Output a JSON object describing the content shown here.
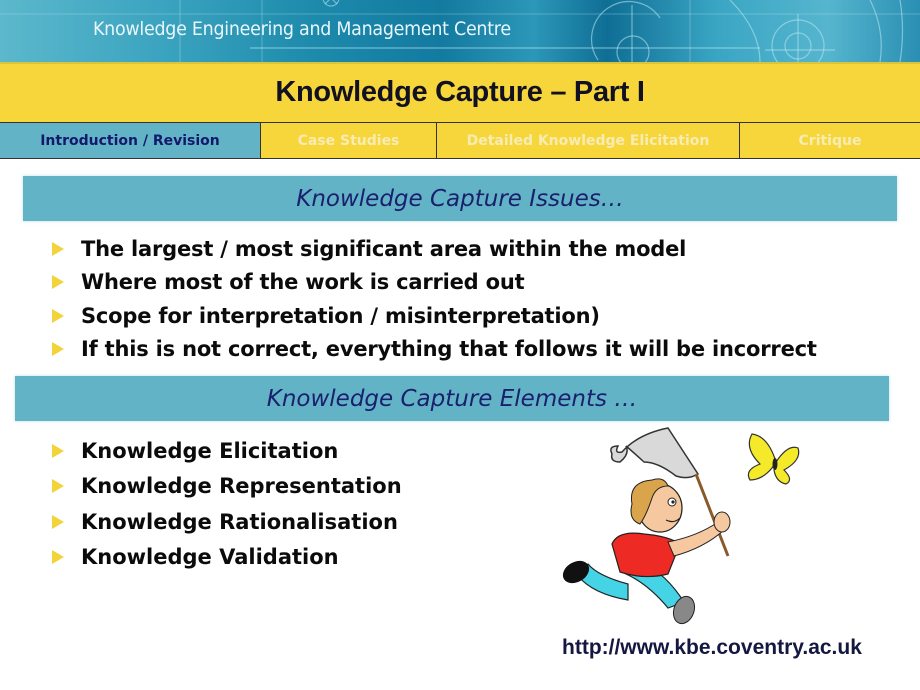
{
  "header": {
    "organisation": "Knowledge Engineering and Management Centre"
  },
  "slide": {
    "title": "Knowledge Capture – Part I"
  },
  "tabs": [
    {
      "label": "Introduction / Revision",
      "active": true
    },
    {
      "label": "Case Studies",
      "active": false
    },
    {
      "label": "Detailed Knowledge Elicitation",
      "active": false
    },
    {
      "label": "Critique",
      "active": false
    }
  ],
  "sections": {
    "issues": {
      "heading": "Knowledge Capture Issues…",
      "items": [
        "The largest / most significant area within the model",
        "Where most of the work is carried out",
        "Scope for interpretation / misinterpretation)",
        "If this is not correct, everything that follows it will be incorrect"
      ]
    },
    "elements": {
      "heading": "Knowledge Capture Elements …",
      "items": [
        "Knowledge Elicitation",
        "Knowledge Representation",
        "Knowledge Rationalisation",
        "Knowledge Validation"
      ]
    }
  },
  "illustration": {
    "description": "boy-chasing-butterfly-with-net"
  },
  "footer": {
    "url": "http://www.kbe.coventry.ac.uk"
  },
  "colors": {
    "title_bar": "#f7d63c",
    "section_bar": "#63b3c7",
    "heading_text": "#1a1f6e",
    "bullet": "#f3d33b"
  }
}
